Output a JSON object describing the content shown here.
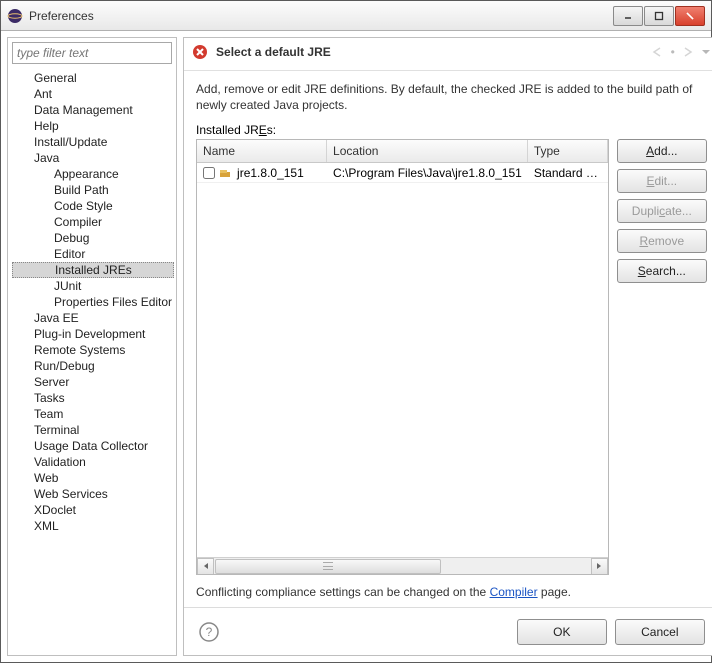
{
  "window": {
    "title": "Preferences"
  },
  "filter": {
    "placeholder": "type filter text"
  },
  "tree": {
    "items": [
      {
        "label": "General",
        "level": 0
      },
      {
        "label": "Ant",
        "level": 0
      },
      {
        "label": "Data Management",
        "level": 0
      },
      {
        "label": "Help",
        "level": 0
      },
      {
        "label": "Install/Update",
        "level": 0
      },
      {
        "label": "Java",
        "level": 0
      },
      {
        "label": "Appearance",
        "level": 1
      },
      {
        "label": "Build Path",
        "level": 1
      },
      {
        "label": "Code Style",
        "level": 1
      },
      {
        "label": "Compiler",
        "level": 1
      },
      {
        "label": "Debug",
        "level": 1
      },
      {
        "label": "Editor",
        "level": 1
      },
      {
        "label": "Installed JREs",
        "level": 1,
        "selected": true
      },
      {
        "label": "JUnit",
        "level": 1
      },
      {
        "label": "Properties Files Editor",
        "level": 1
      },
      {
        "label": "Java EE",
        "level": 0
      },
      {
        "label": "Plug-in Development",
        "level": 0
      },
      {
        "label": "Remote Systems",
        "level": 0
      },
      {
        "label": "Run/Debug",
        "level": 0
      },
      {
        "label": "Server",
        "level": 0
      },
      {
        "label": "Tasks",
        "level": 0
      },
      {
        "label": "Team",
        "level": 0
      },
      {
        "label": "Terminal",
        "level": 0
      },
      {
        "label": "Usage Data Collector",
        "level": 0
      },
      {
        "label": "Validation",
        "level": 0
      },
      {
        "label": "Web",
        "level": 0
      },
      {
        "label": "Web Services",
        "level": 0
      },
      {
        "label": "XDoclet",
        "level": 0
      },
      {
        "label": "XML",
        "level": 0
      }
    ]
  },
  "header": {
    "title": "Select a default JRE"
  },
  "description": "Add, remove or edit JRE definitions. By default, the checked JRE is added to the build path of newly created Java projects.",
  "installed_label_pre": "Installed JR",
  "installed_label_u": "E",
  "installed_label_post": "s:",
  "table": {
    "cols": {
      "name": "Name",
      "location": "Location",
      "type": "Type"
    },
    "rows": [
      {
        "name": "jre1.8.0_151",
        "location": "C:\\Program Files\\Java\\jre1.8.0_151",
        "type": "Standard VM"
      }
    ]
  },
  "buttons": {
    "add_pre": "",
    "add_u": "A",
    "add_post": "dd...",
    "edit_pre": "",
    "edit_u": "E",
    "edit_post": "dit...",
    "dup_pre": "Dupli",
    "dup_u": "c",
    "dup_post": "ate...",
    "rem_pre": "",
    "rem_u": "R",
    "rem_post": "emove",
    "search_pre": "",
    "search_u": "S",
    "search_post": "earch..."
  },
  "compliance": {
    "pre": "Conflicting compliance settings can be changed on the ",
    "link": "Compiler",
    "post": " page."
  },
  "footer": {
    "ok": "OK",
    "cancel": "Cancel"
  }
}
